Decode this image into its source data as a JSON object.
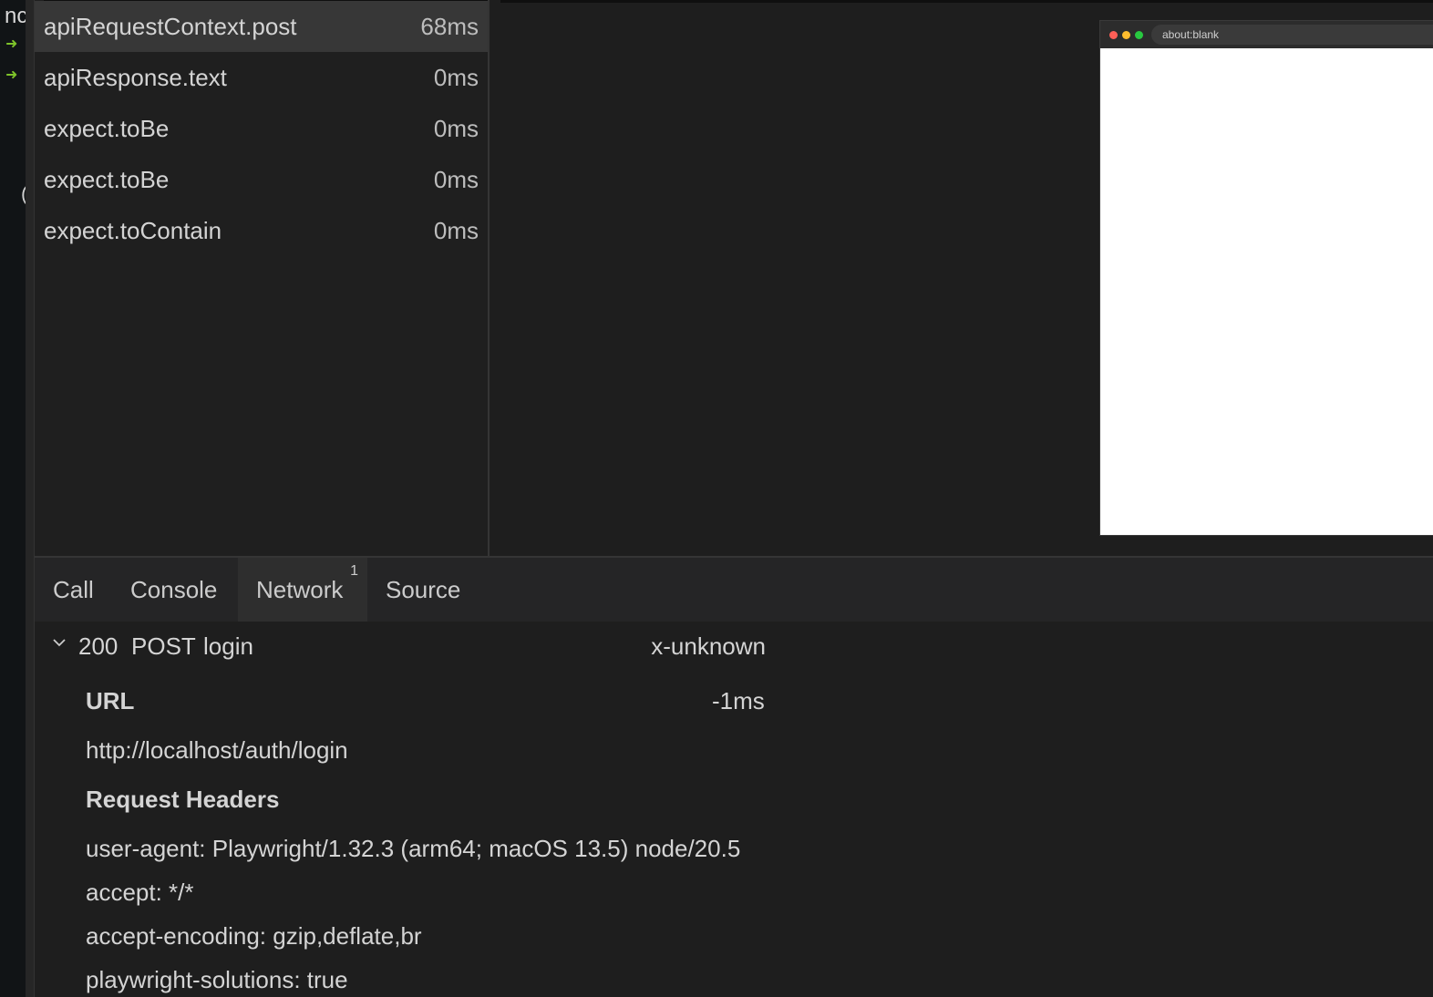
{
  "terminal": {
    "visible_text": "nc",
    "arrow_glyph": "➜",
    "paren_glyph": "("
  },
  "actions": [
    {
      "name": "apiRequestContext.post",
      "duration": "68ms",
      "selected": true
    },
    {
      "name": "apiResponse.text",
      "duration": "0ms",
      "selected": false
    },
    {
      "name": "expect.toBe",
      "duration": "0ms",
      "selected": false
    },
    {
      "name": "expect.toBe",
      "duration": "0ms",
      "selected": false
    },
    {
      "name": "expect.toContain",
      "duration": "0ms",
      "selected": false
    }
  ],
  "snapshot": {
    "url": "about:blank"
  },
  "tabs": [
    {
      "label": "Call",
      "active": false
    },
    {
      "label": "Console",
      "active": false
    },
    {
      "label": "Network",
      "active": true,
      "badge": "1"
    },
    {
      "label": "Source",
      "active": false
    }
  ],
  "network": {
    "request": {
      "status": "200",
      "method": "POST",
      "name": "login",
      "content_type": "x-unknown",
      "url_heading": "URL",
      "duration": "-1ms",
      "url": "http://localhost/auth/login",
      "headers_heading": "Request Headers",
      "headers": [
        "user-agent: Playwright/1.32.3 (arm64; macOS 13.5) node/20.5",
        "accept: */*",
        "accept-encoding: gzip,deflate,br",
        "playwright-solutions: true"
      ]
    }
  },
  "colors": {
    "background": "#1e1e1e",
    "selected_row": "#373737",
    "terminal_arrow": "#7ec32a",
    "traffic_red": "#ff5f57",
    "traffic_yellow": "#febc2e",
    "traffic_green": "#28c840"
  }
}
